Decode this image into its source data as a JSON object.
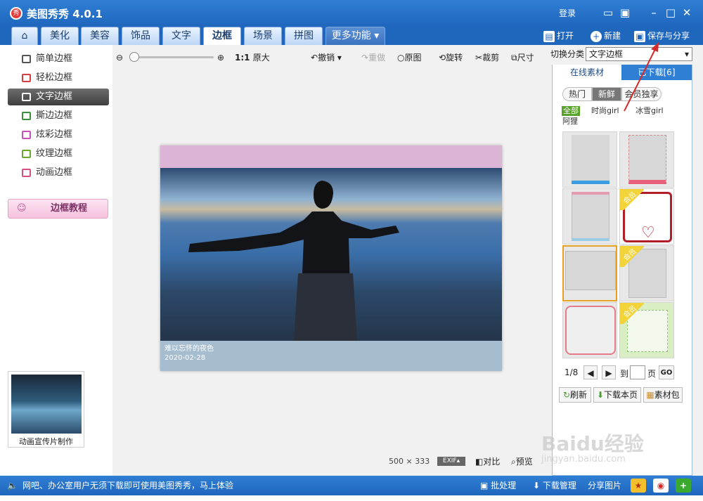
{
  "app": {
    "title": "美图秀秀 4.0.1",
    "login": "登录"
  },
  "tabs": [
    "美化",
    "美容",
    "饰品",
    "文字",
    "边框",
    "场景",
    "拼图",
    "更多功能"
  ],
  "toolbar_right": {
    "open": "打开",
    "new": "新建",
    "save": "保存与分享"
  },
  "left_menu": {
    "items": [
      "简单边框",
      "轻松边框",
      "文字边框",
      "撕边边框",
      "炫彩边框",
      "纹理边框",
      "动画边框"
    ],
    "tutorial": "边框教程",
    "promo_label": "动画宣传片制作"
  },
  "edit_toolbar": {
    "zoom_ratio": "1:1",
    "original_size": "原大",
    "undo": "撤销",
    "redo": "重做",
    "original": "原图",
    "rotate": "旋转",
    "crop": "裁剪",
    "size": "尺寸"
  },
  "photo": {
    "caption_title": "难以忘怀的夜色",
    "caption_date": "2020-02-28"
  },
  "status": {
    "width": "500",
    "times": "×",
    "height": "333",
    "exif": "EXIF",
    "compare": "对比",
    "preview": "预览"
  },
  "right_panel": {
    "switch_label": "切换分类",
    "category_selected": "文字边框",
    "tab_online": "在线素材",
    "tab_downloaded": "已下载[6]",
    "pills": [
      "热门",
      "新鲜",
      "会员独享"
    ],
    "cats": [
      "全部",
      "时尚girl",
      "冰雪girl",
      "阿狸"
    ],
    "vip_tag": "会员",
    "page": "1/8",
    "to": "到",
    "page_unit": "页",
    "go": "GO",
    "refresh": "刷新",
    "download_page": "下载本页",
    "pack": "素材包"
  },
  "statusbar": {
    "message": "网吧、办公室用户无须下载即可使用美图秀秀，马上体验",
    "batch": "批处理",
    "download_manager": "下载管理",
    "share": "分享图片"
  },
  "watermark": "Baidu经验",
  "watermark_url": "jingyan.baidu.com",
  "colors": {
    "title_bar": "#1f66bd",
    "accent_red": "#d42a2a",
    "selected_orange": "#e8a020"
  }
}
